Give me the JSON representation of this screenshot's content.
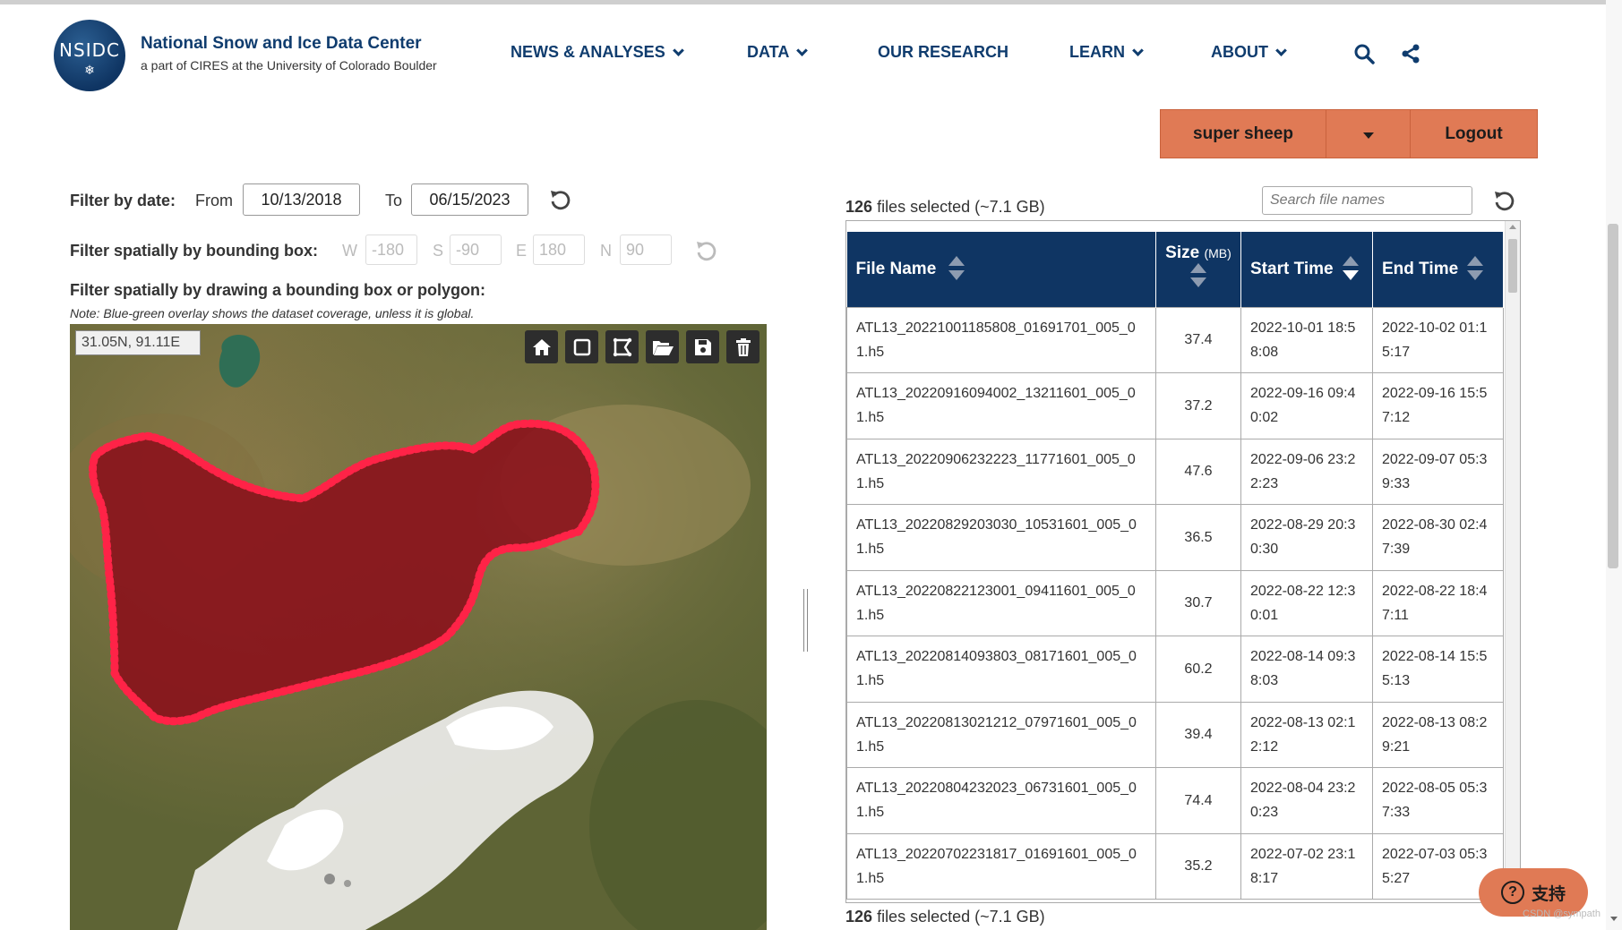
{
  "header": {
    "logo_text": "NSIDC",
    "org_name": "National Snow and Ice Data Center",
    "org_sub": "a part of CIRES at the University of Colorado Boulder",
    "nav": [
      {
        "label": "NEWS & ANALYSES",
        "dropdown": true
      },
      {
        "label": "DATA",
        "dropdown": true
      },
      {
        "label": "OUR RESEARCH",
        "dropdown": false
      },
      {
        "label": "LEARN",
        "dropdown": true
      },
      {
        "label": "ABOUT",
        "dropdown": true
      }
    ],
    "icons": [
      "search-icon",
      "share-icon"
    ]
  },
  "user": {
    "name": "super sheep",
    "logout_label": "Logout",
    "accent_color": "#e07a55"
  },
  "filters": {
    "date_label": "Filter by date:",
    "from_label": "From",
    "from_value": "10/13/2018",
    "to_label": "To",
    "to_value": "06/15/2023",
    "bbox_label": "Filter spatially by bounding box:",
    "bbox": {
      "w_label": "W",
      "w_value": "-180",
      "s_label": "S",
      "s_value": "-90",
      "e_label": "E",
      "e_value": "180",
      "n_label": "N",
      "n_value": "90"
    },
    "draw_label": "Filter spatially by drawing a bounding box or polygon:",
    "note": "Note: Blue-green overlay shows the dataset coverage, unless it is global."
  },
  "map": {
    "coordinate_readout": "31.05N, 91.11E",
    "tools": [
      "home-icon",
      "rectangle-icon",
      "polygon-icon",
      "folder-open-icon",
      "save-icon",
      "trash-icon"
    ],
    "polygon_color": "#e8143c"
  },
  "files": {
    "count": "126",
    "summary": "files selected (~7.1 GB)",
    "search_placeholder": "Search file names",
    "columns": [
      "File Name",
      "Size",
      "(MB)",
      "Start Time",
      "End Time"
    ],
    "header_color": "#0f3563",
    "rows": [
      {
        "name": "ATL13_20221001185808_01691701_005_01.h5",
        "size": "37.4",
        "start": "2022-10-01 18:58:08",
        "end": "2022-10-02 01:15:17"
      },
      {
        "name": "ATL13_20220916094002_13211601_005_01.h5",
        "size": "37.2",
        "start": "2022-09-16 09:40:02",
        "end": "2022-09-16 15:57:12"
      },
      {
        "name": "ATL13_20220906232223_11771601_005_01.h5",
        "size": "47.6",
        "start": "2022-09-06 23:22:23",
        "end": "2022-09-07 05:39:33"
      },
      {
        "name": "ATL13_20220829203030_10531601_005_01.h5",
        "size": "36.5",
        "start": "2022-08-29 20:30:30",
        "end": "2022-08-30 02:47:39"
      },
      {
        "name": "ATL13_20220822123001_09411601_005_01.h5",
        "size": "30.7",
        "start": "2022-08-22 12:30:01",
        "end": "2022-08-22 18:47:11"
      },
      {
        "name": "ATL13_20220814093803_08171601_005_01.h5",
        "size": "60.2",
        "start": "2022-08-14 09:38:03",
        "end": "2022-08-14 15:55:13"
      },
      {
        "name": "ATL13_20220813021212_07971601_005_01.h5",
        "size": "39.4",
        "start": "2022-08-13 02:12:12",
        "end": "2022-08-13 08:29:21"
      },
      {
        "name": "ATL13_20220804232023_06731601_005_01.h5",
        "size": "74.4",
        "start": "2022-08-04 23:20:23",
        "end": "2022-08-05 05:37:33"
      },
      {
        "name": "ATL13_20220702231817_01691601_005_01.h5",
        "size": "35.2",
        "start": "2022-07-02 23:18:17",
        "end": "2022-07-03 05:35:27"
      }
    ]
  },
  "support": {
    "label": "支持"
  },
  "watermark": "CSDN @sympath"
}
